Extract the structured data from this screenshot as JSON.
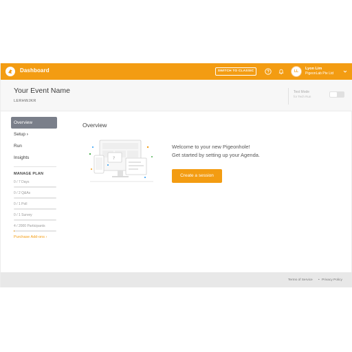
{
  "topbar": {
    "title": "Dashboard",
    "switch_label": "SWITCH TO CLASSIC",
    "help_icon": "help-circle-icon",
    "notification_icon": "bell-icon",
    "user": {
      "initials": "LL",
      "name": "Lyon Lim",
      "org": "PigeonLab Pte Ltd"
    },
    "accent_color": "#f39c12"
  },
  "event": {
    "name": "Your Event Name",
    "code": "LERHWJKR",
    "test_mode_label": "Test Mode",
    "test_mode_sub": "for Tech Run",
    "test_mode_on": false
  },
  "sidebar": {
    "nav": [
      {
        "label": "Overview",
        "active": true
      },
      {
        "label": "Setup",
        "chevron": "›"
      },
      {
        "label": "Run"
      },
      {
        "label": "Insights"
      }
    ],
    "plan_title": "MANAGE PLAN",
    "plan_items": [
      {
        "label": "0 / 7 Days",
        "fraction": 0
      },
      {
        "label": "0 / 2 Q&As",
        "fraction": 0
      },
      {
        "label": "0 / 1 Poll",
        "fraction": 0
      },
      {
        "label": "0 / 1 Survey",
        "fraction": 0
      },
      {
        "label": "4 / 2000 Participants",
        "fraction": 0.002
      }
    ],
    "addons_label": "Purchase Add-ons",
    "addons_chevron": "›"
  },
  "main": {
    "title": "Overview",
    "welcome_line1": "Welcome to your new Pigeonhole!",
    "welcome_line2": "Get started by setting up your Agenda.",
    "create_button": "Create a session"
  },
  "footer": {
    "terms": "Terms of Service",
    "separator": "•",
    "privacy": "Privacy Policy"
  }
}
